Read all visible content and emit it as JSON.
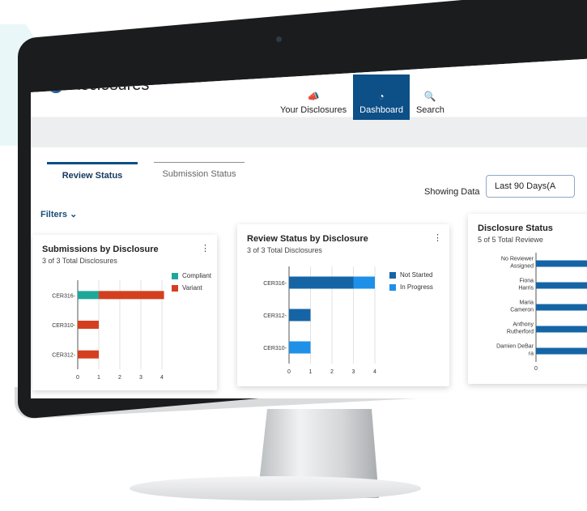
{
  "app": {
    "title": "Disclosures"
  },
  "nav": [
    {
      "label": "Your Disclosures",
      "icon": "megaphone-icon",
      "glyph": "📣",
      "active": false
    },
    {
      "label": "Dashboard",
      "icon": "gauge-icon",
      "glyph": "◔",
      "active": true
    },
    {
      "label": "Search",
      "icon": "search-icon",
      "glyph": "🔍",
      "active": false
    }
  ],
  "tabs": [
    {
      "label": "Review Status",
      "active": true
    },
    {
      "label": "Submission Status",
      "active": false
    }
  ],
  "showing": {
    "label": "Showing Data",
    "value": "Last 90 Days(A"
  },
  "filters": {
    "label": "Filters",
    "chevron": "⌄"
  },
  "cards": {
    "submissions": {
      "title": "Submissions by Disclosure",
      "subtitle_count": "3 of 3",
      "subtitle_label": "Total Disclosures",
      "menu": "⋮"
    },
    "review": {
      "title": "Review Status by Disclosure",
      "subtitle_count": "3 of 3",
      "subtitle_label": "Total Disclosures",
      "menu": "⋮"
    },
    "disclosure_status": {
      "title": "Disclosure Status",
      "subtitle_count": "5 of 5",
      "subtitle_label": "Total Reviewe"
    }
  },
  "colors": {
    "primary": "#0d4f87",
    "compliant": "#1fa89a",
    "variant": "#d4401f",
    "not_started": "#1565a6",
    "in_progress": "#1e90e8"
  },
  "chart_data": [
    {
      "type": "bar",
      "orientation": "horizontal",
      "categories": [
        "CER316-",
        "CER310-",
        "CER312-"
      ],
      "series": [
        {
          "name": "Compliant",
          "values": [
            1,
            0,
            0
          ]
        },
        {
          "name": "Variant",
          "values": [
            3.1,
            1,
            1
          ]
        }
      ],
      "xticks": [
        "0",
        "1",
        "2",
        "3",
        "4"
      ],
      "xlim": [
        0,
        4
      ],
      "stacked": true
    },
    {
      "type": "bar",
      "orientation": "horizontal",
      "categories": [
        "CER316-",
        "CER312-",
        "CER310-"
      ],
      "series": [
        {
          "name": "Not Started",
          "values": [
            3,
            1,
            0
          ]
        },
        {
          "name": "In Progress",
          "values": [
            1,
            0,
            1
          ]
        }
      ],
      "xticks": [
        "0",
        "1",
        "2",
        "3",
        "4"
      ],
      "xlim": [
        0,
        4
      ],
      "stacked": true
    },
    {
      "type": "bar",
      "orientation": "horizontal",
      "categories": [
        "No Reviewer Assigned",
        "Fiona Harris",
        "Maria Cameron",
        "Anthony Rutherford",
        "Damien DeBar ra"
      ],
      "series": [
        {
          "name": "",
          "values": [
            1,
            1,
            1,
            1,
            1
          ]
        }
      ],
      "xticks": [
        "0"
      ]
    }
  ]
}
